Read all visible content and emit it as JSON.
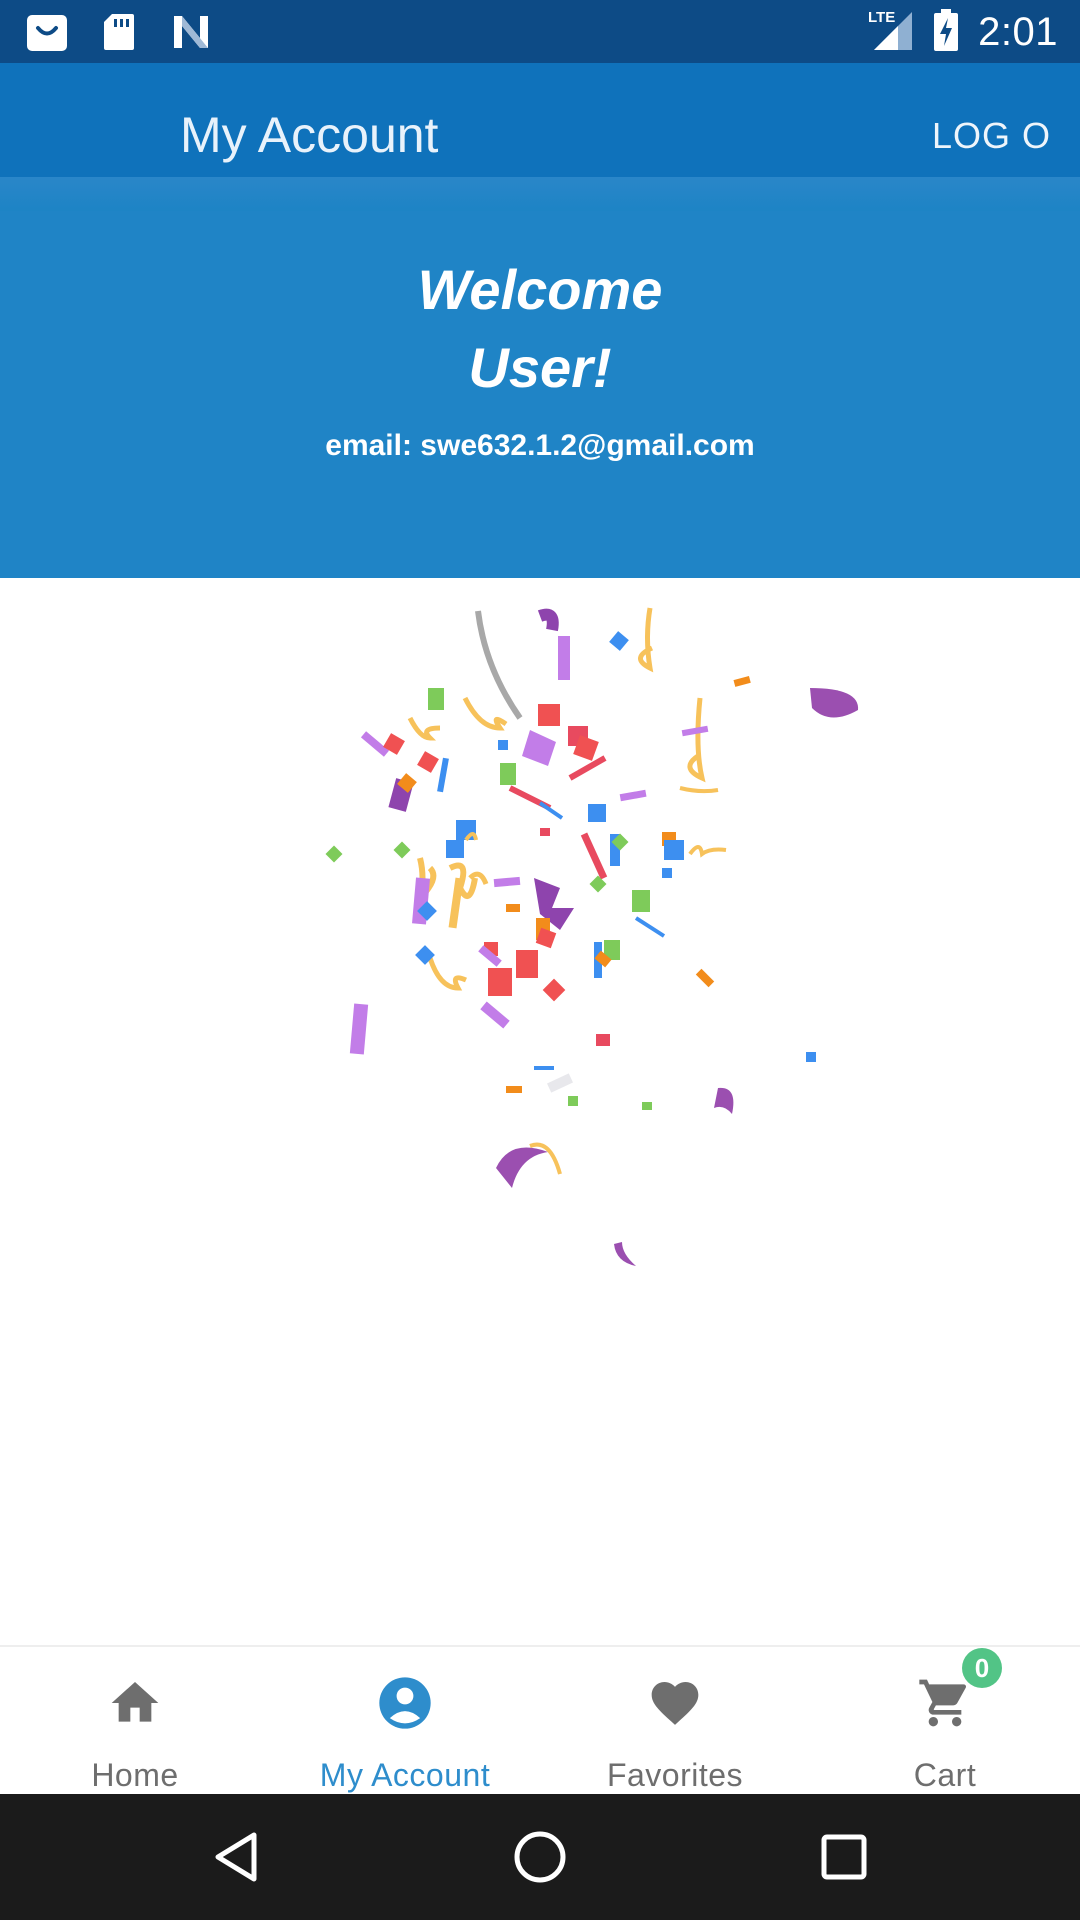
{
  "status_bar": {
    "time": "2:01",
    "network": "LTE",
    "left_icons": [
      "shopping-bag-icon",
      "sd-card-icon",
      "n-logo-icon"
    ],
    "right_icons": [
      "lte-signal-icon",
      "battery-charging-icon"
    ]
  },
  "app_bar": {
    "title": "My Account",
    "logout_label": "LOG OUT"
  },
  "welcome": {
    "line1": "Welcome",
    "line2": "User!",
    "email": "email: swe632.1.2@gmail.com"
  },
  "bottom_nav": {
    "items": [
      {
        "label": "Home",
        "icon": "home-icon"
      },
      {
        "label": "My Account",
        "icon": "account-icon"
      },
      {
        "label": "Favorites",
        "icon": "heart-icon"
      },
      {
        "label": "Cart",
        "icon": "cart-icon"
      }
    ],
    "active": "My Account",
    "cart_count": "0"
  },
  "colors": {
    "status_bar": "#0d4b86",
    "app_bar": "#0f72bb",
    "header": "#1f84c6",
    "active_nav": "#2e8dcc",
    "badge": "#52c486",
    "system_nav": "#1b1b1b"
  },
  "system_nav": {
    "icons": [
      "back-icon",
      "home-circle-icon",
      "recents-icon"
    ]
  }
}
